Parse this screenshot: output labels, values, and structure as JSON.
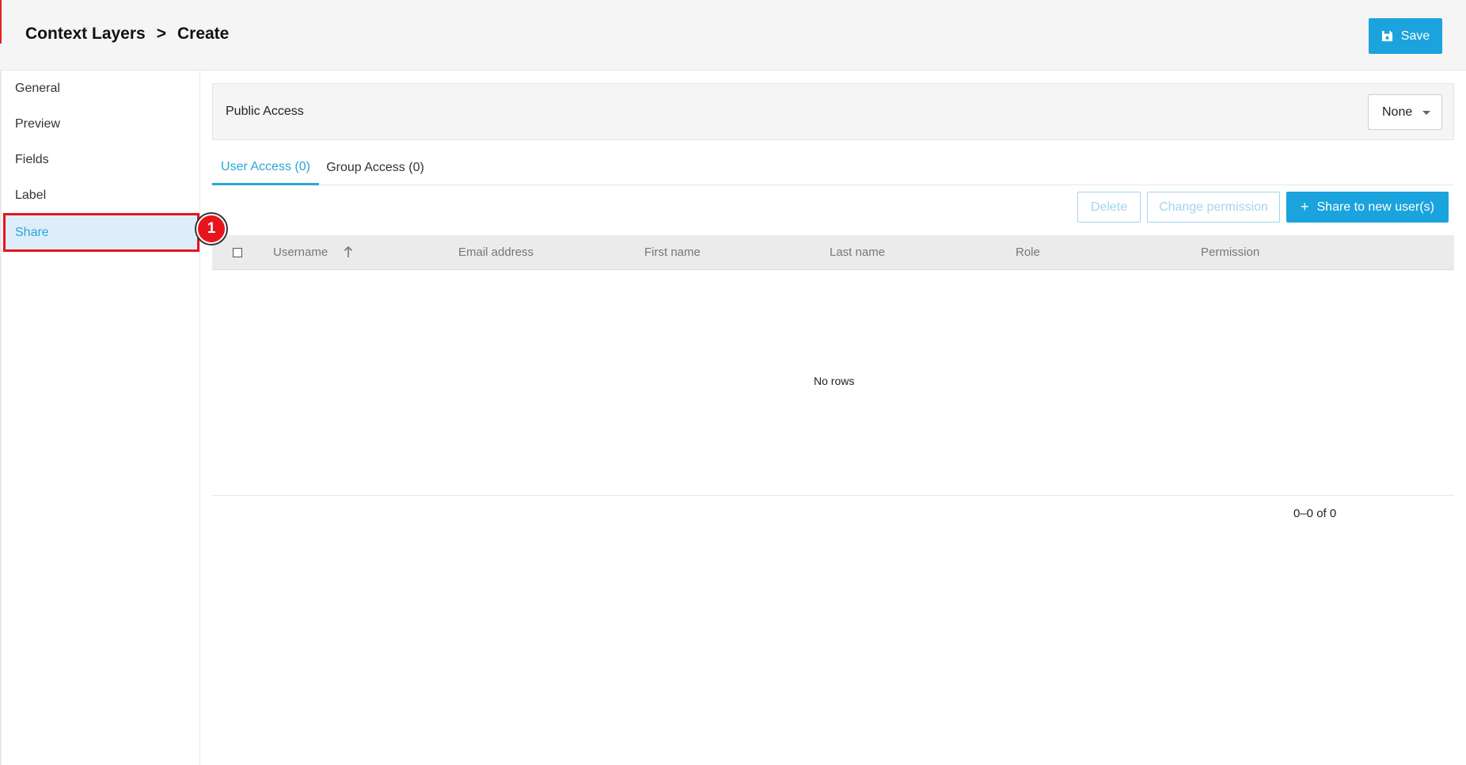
{
  "header": {
    "breadcrumb_root": "Context Layers",
    "breadcrumb_sep": ">",
    "breadcrumb_current": "Create",
    "save_label": "Save"
  },
  "sidebar": {
    "items": [
      {
        "label": "General"
      },
      {
        "label": "Preview"
      },
      {
        "label": "Fields"
      },
      {
        "label": "Label"
      },
      {
        "label": "Share"
      }
    ],
    "annotation_number": "1"
  },
  "public_access": {
    "label": "Public Access",
    "selected": "None"
  },
  "tabs": [
    {
      "label": "User Access (0)"
    },
    {
      "label": "Group Access (0)"
    }
  ],
  "actions": {
    "delete_label": "Delete",
    "change_permission_label": "Change permission",
    "share_label": "Share to new user(s)",
    "share_icon": "+"
  },
  "table": {
    "columns": [
      "Username",
      "Email address",
      "First name",
      "Last name",
      "Role",
      "Permission"
    ],
    "empty_text": "No rows",
    "pagination": "0–0 of 0"
  },
  "colors": {
    "accent": "#1aa3dc",
    "annotation": "#e8141c"
  }
}
